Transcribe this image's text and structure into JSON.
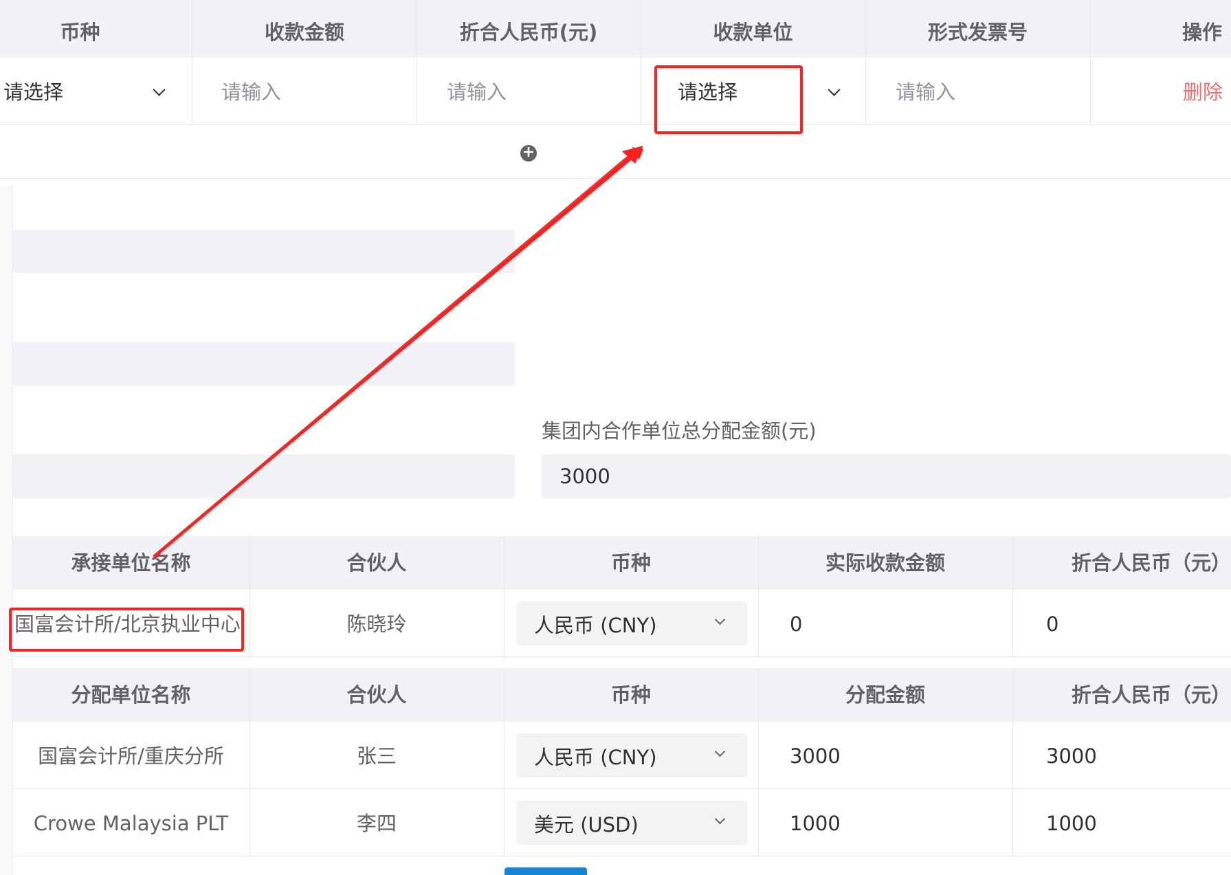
{
  "receipt_table": {
    "headers": [
      "币种",
      "收款金额",
      "折合人民币(元)",
      "收款单位",
      "形式发票号",
      "操作"
    ],
    "row": {
      "currency_placeholder": "请选择",
      "amount_placeholder": "请输入",
      "rmb_placeholder": "请输入",
      "unit_placeholder": "请选择",
      "invoice_placeholder": "请输入",
      "delete_label": "删除"
    },
    "add_icon": "plus-circle-icon"
  },
  "allocation": {
    "total_label": "集团内合作单位总分配金额(元)",
    "total_value": "3000"
  },
  "undertake_table": {
    "headers": [
      "承接单位名称",
      "合伙人",
      "币种",
      "实际收款金额",
      "折合人民币（元）"
    ],
    "rows": [
      {
        "unit": "国富会计所/北京执业中心",
        "partner": "陈晓玲",
        "currency": "人民币 (CNY)",
        "amount": "0",
        "rmb": "0"
      }
    ]
  },
  "distribute_table": {
    "headers": [
      "分配单位名称",
      "合伙人",
      "币种",
      "分配金额",
      "折合人民币（元）"
    ],
    "rows": [
      {
        "unit": "国富会计所/重庆分所",
        "partner": "张三",
        "currency": "人民币 (CNY)",
        "amount": "3000",
        "rmb": "3000"
      },
      {
        "unit": "Crowe Malaysia PLT",
        "partner": "李四",
        "currency": "美元 (USD)",
        "amount": "1000",
        "rmb": "1000"
      }
    ]
  },
  "annotation": {
    "color": "#ff1f1f"
  }
}
